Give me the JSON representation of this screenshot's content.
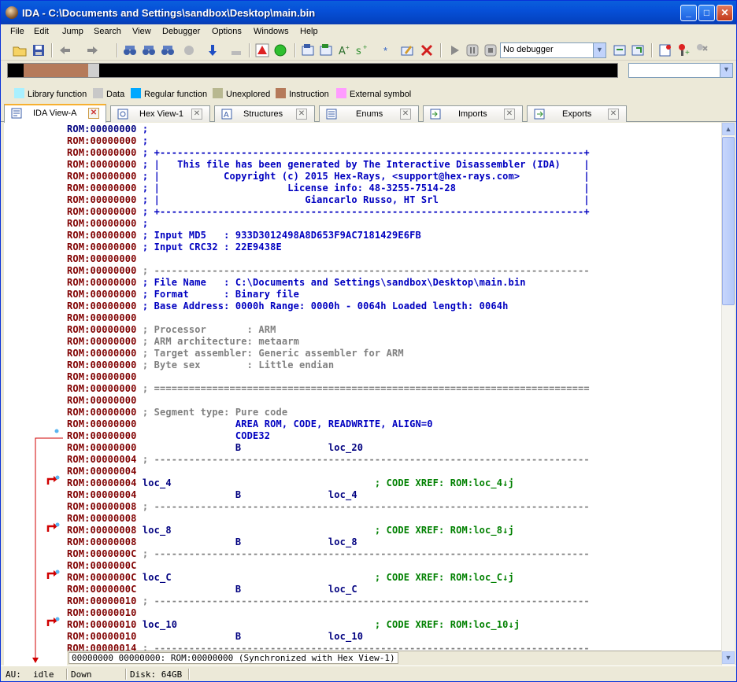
{
  "window": {
    "title": "IDA - C:\\Documents and Settings\\sandbox\\Desktop\\main.bin",
    "min": "_",
    "max": "□",
    "close": "✕"
  },
  "menu": [
    "File",
    "Edit",
    "Jump",
    "Search",
    "View",
    "Debugger",
    "Options",
    "Windows",
    "Help"
  ],
  "toolbar": {
    "debugger_select": "No debugger"
  },
  "legend": [
    {
      "label": "Library function",
      "color": "#a9f0ff"
    },
    {
      "label": "Data",
      "color": "#c8c8c8"
    },
    {
      "label": "Regular function",
      "color": "#00a8ff"
    },
    {
      "label": "Unexplored",
      "color": "#b8b890"
    },
    {
      "label": "Instruction",
      "color": "#b57a5a"
    },
    {
      "label": "External symbol",
      "color": "#ff9cff"
    }
  ],
  "tabs": [
    {
      "label": "IDA View-A",
      "icon": "ida-view-icon"
    },
    {
      "label": "Hex View-1",
      "icon": "hex-view-icon"
    },
    {
      "label": "Structures",
      "icon": "structures-icon"
    },
    {
      "label": "Enums",
      "icon": "enums-icon"
    },
    {
      "label": "Imports",
      "icon": "imports-icon"
    },
    {
      "label": "Exports",
      "icon": "exports-icon"
    }
  ],
  "listing": [
    {
      "addr": "ROM:00000000",
      "text": " ;",
      "cls": "c-blue",
      "sel": true
    },
    {
      "addr": "ROM:00000000",
      "text": " ;",
      "cls": "c-blue"
    },
    {
      "addr": "ROM:00000000",
      "text": " ; +-------------------------------------------------------------------------+",
      "cls": "c-blue"
    },
    {
      "addr": "ROM:00000000",
      "text": " ; |   This file has been generated by The Interactive Disassembler (IDA)    |",
      "cls": "c-blue"
    },
    {
      "addr": "ROM:00000000",
      "text": " ; |           Copyright (c) 2015 Hex-Rays, <support@hex-rays.com>           |",
      "cls": "c-blue"
    },
    {
      "addr": "ROM:00000000",
      "text": " ; |                      License info: 48-3255-7514-28                      |",
      "cls": "c-blue"
    },
    {
      "addr": "ROM:00000000",
      "text": " ; |                         Giancarlo Russo, HT Srl                         |",
      "cls": "c-blue"
    },
    {
      "addr": "ROM:00000000",
      "text": " ; +-------------------------------------------------------------------------+",
      "cls": "c-blue"
    },
    {
      "addr": "ROM:00000000",
      "text": " ;",
      "cls": "c-blue"
    },
    {
      "addr": "ROM:00000000",
      "text": " ; Input MD5   : 933D3012498A8D653F9AC7181429E6FB",
      "cls": "c-blue"
    },
    {
      "addr": "ROM:00000000",
      "text": " ; Input CRC32 : 22E9438E",
      "cls": "c-blue"
    },
    {
      "addr": "ROM:00000000",
      "text": "",
      "cls": "c-blue"
    },
    {
      "addr": "ROM:00000000",
      "text": " ; ---------------------------------------------------------------------------",
      "cls": "c-gray"
    },
    {
      "addr": "ROM:00000000",
      "text": " ; File Name   : C:\\Documents and Settings\\sandbox\\Desktop\\main.bin",
      "cls": "c-blue"
    },
    {
      "addr": "ROM:00000000",
      "text": " ; Format      : Binary file",
      "cls": "c-blue"
    },
    {
      "addr": "ROM:00000000",
      "text": " ; Base Address: 0000h Range: 0000h - 0064h Loaded length: 0064h",
      "cls": "c-blue"
    },
    {
      "addr": "ROM:00000000",
      "text": "",
      "cls": "c-blue"
    },
    {
      "addr": "ROM:00000000",
      "text": " ; Processor       : ARM",
      "cls": "c-gray"
    },
    {
      "addr": "ROM:00000000",
      "text": " ; ARM architecture: metaarm",
      "cls": "c-gray"
    },
    {
      "addr": "ROM:00000000",
      "text": " ; Target assembler: Generic assembler for ARM",
      "cls": "c-gray"
    },
    {
      "addr": "ROM:00000000",
      "text": " ; Byte sex        : Little endian",
      "cls": "c-gray"
    },
    {
      "addr": "ROM:00000000",
      "text": "",
      "cls": "c-blue"
    },
    {
      "addr": "ROM:00000000",
      "text": " ; ===========================================================================",
      "cls": "c-gray"
    },
    {
      "addr": "ROM:00000000",
      "text": "",
      "cls": "c-blue"
    },
    {
      "addr": "ROM:00000000",
      "text": " ; Segment type: Pure code",
      "cls": "c-gray"
    },
    {
      "addr": "ROM:00000000",
      "text": "                 AREA ROM, CODE, READWRITE, ALIGN=0",
      "cls": "c-blue"
    },
    {
      "addr": "ROM:00000000",
      "text": "                 CODE32",
      "cls": "c-blue"
    },
    {
      "addr": "ROM:00000000",
      "text": "                 B               loc_20",
      "cls": "c-navy"
    },
    {
      "addr": "ROM:00000004",
      "text": " ; ---------------------------------------------------------------------------",
      "cls": "c-gray"
    },
    {
      "addr": "ROM:00000004",
      "text": "",
      "cls": "c-blue"
    },
    {
      "addr": "ROM:00000004",
      "text": " loc_4                                   ; CODE XREF: ROM:loc_4↓j",
      "cls": "c-navy",
      "xref": true
    },
    {
      "addr": "ROM:00000004",
      "text": "                 B               loc_4",
      "cls": "c-navy"
    },
    {
      "addr": "ROM:00000008",
      "text": " ; ---------------------------------------------------------------------------",
      "cls": "c-gray"
    },
    {
      "addr": "ROM:00000008",
      "text": "",
      "cls": "c-blue"
    },
    {
      "addr": "ROM:00000008",
      "text": " loc_8                                   ; CODE XREF: ROM:loc_8↓j",
      "cls": "c-navy",
      "xref": true
    },
    {
      "addr": "ROM:00000008",
      "text": "                 B               loc_8",
      "cls": "c-navy"
    },
    {
      "addr": "ROM:0000000C",
      "text": " ; ---------------------------------------------------------------------------",
      "cls": "c-gray"
    },
    {
      "addr": "ROM:0000000C",
      "text": "",
      "cls": "c-blue"
    },
    {
      "addr": "ROM:0000000C",
      "text": " loc_C                                   ; CODE XREF: ROM:loc_C↓j",
      "cls": "c-navy",
      "xref": true
    },
    {
      "addr": "ROM:0000000C",
      "text": "                 B               loc_C",
      "cls": "c-navy"
    },
    {
      "addr": "ROM:00000010",
      "text": " ; ---------------------------------------------------------------------------",
      "cls": "c-gray"
    },
    {
      "addr": "ROM:00000010",
      "text": "",
      "cls": "c-blue"
    },
    {
      "addr": "ROM:00000010",
      "text": " loc_10                                  ; CODE XREF: ROM:loc_10↓j",
      "cls": "c-navy",
      "xref": true
    },
    {
      "addr": "ROM:00000010",
      "text": "                 B               loc_10",
      "cls": "c-navy"
    },
    {
      "addr": "ROM:00000014",
      "text": " ; ---------------------------------------------------------------------------",
      "cls": "c-gray"
    }
  ],
  "sync": "00000000 00000000: ROM:00000000 (Synchronized with Hex View-1)",
  "status": {
    "au_label": "AU:",
    "au_value": "idle",
    "direction": "Down",
    "disk": "Disk: 64GB"
  }
}
